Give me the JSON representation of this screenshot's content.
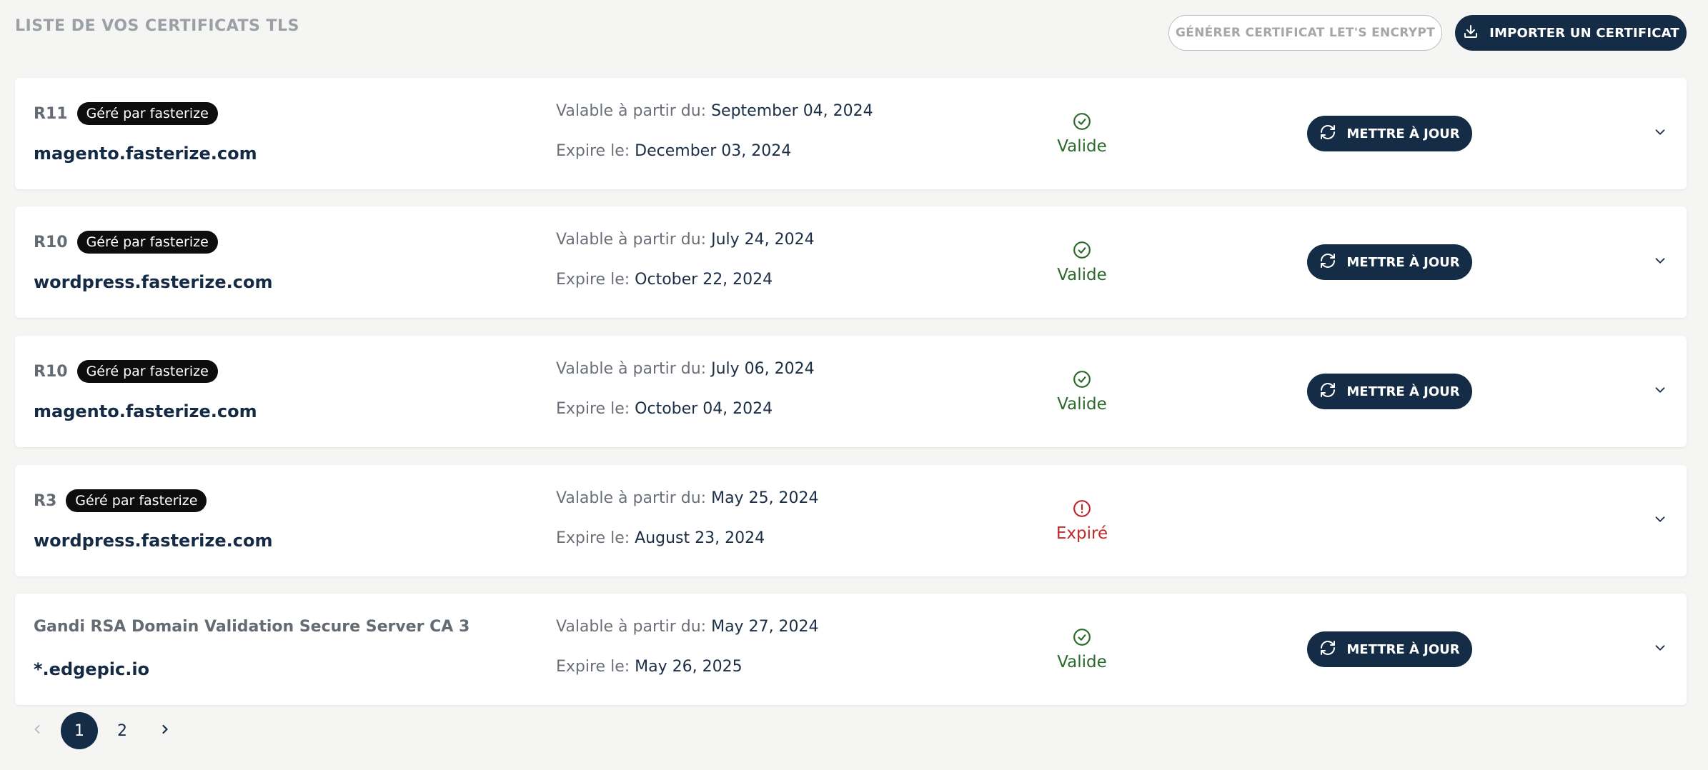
{
  "header": {
    "title": "LISTE DE VOS CERTIFICATS TLS",
    "generate_label": "GÉNÉRER CERTIFICAT LET'S ENCRYPT",
    "import_label": "IMPORTER UN CERTIFICAT"
  },
  "labels": {
    "valid_from": "Valable à partir du:",
    "expires": "Expire le:",
    "update": "METTRE À JOUR"
  },
  "certificates": [
    {
      "issuer": "R11",
      "badge": "Géré par fasterize",
      "domain": "magento.fasterize.com",
      "from": "September 04, 2024",
      "to": "December 03, 2024",
      "status": "Valide"
    },
    {
      "issuer": "R10",
      "badge": "Géré par fasterize",
      "domain": "wordpress.fasterize.com",
      "from": "July 24, 2024",
      "to": "October 22, 2024",
      "status": "Valide"
    },
    {
      "issuer": "R10",
      "badge": "Géré par fasterize",
      "domain": "magento.fasterize.com",
      "from": "July 06, 2024",
      "to": "October 04, 2024",
      "status": "Valide"
    },
    {
      "issuer": "R3",
      "badge": "Géré par fasterize",
      "domain": "wordpress.fasterize.com",
      "from": "May 25, 2024",
      "to": "August 23, 2024",
      "status": "Expiré"
    },
    {
      "issuer": "Gandi RSA Domain Validation Secure Server CA 3",
      "domain": "*.edgepic.io",
      "from": "May 27, 2024",
      "to": "May 26, 2025",
      "status": "Valide"
    }
  ],
  "pagination": {
    "pages": [
      "1",
      "2"
    ],
    "current": "1"
  },
  "colors": {
    "primary": "#142c45",
    "valid": "#2c6a2c",
    "expired": "#c0282a",
    "badge": "#0d0d0d",
    "background": "#f5f5f4"
  },
  "icons": {
    "import": "download-icon",
    "update": "refresh-icon",
    "valid": "check-circle-icon",
    "expired": "alert-circle-icon",
    "expand": "chevron-down-icon"
  }
}
